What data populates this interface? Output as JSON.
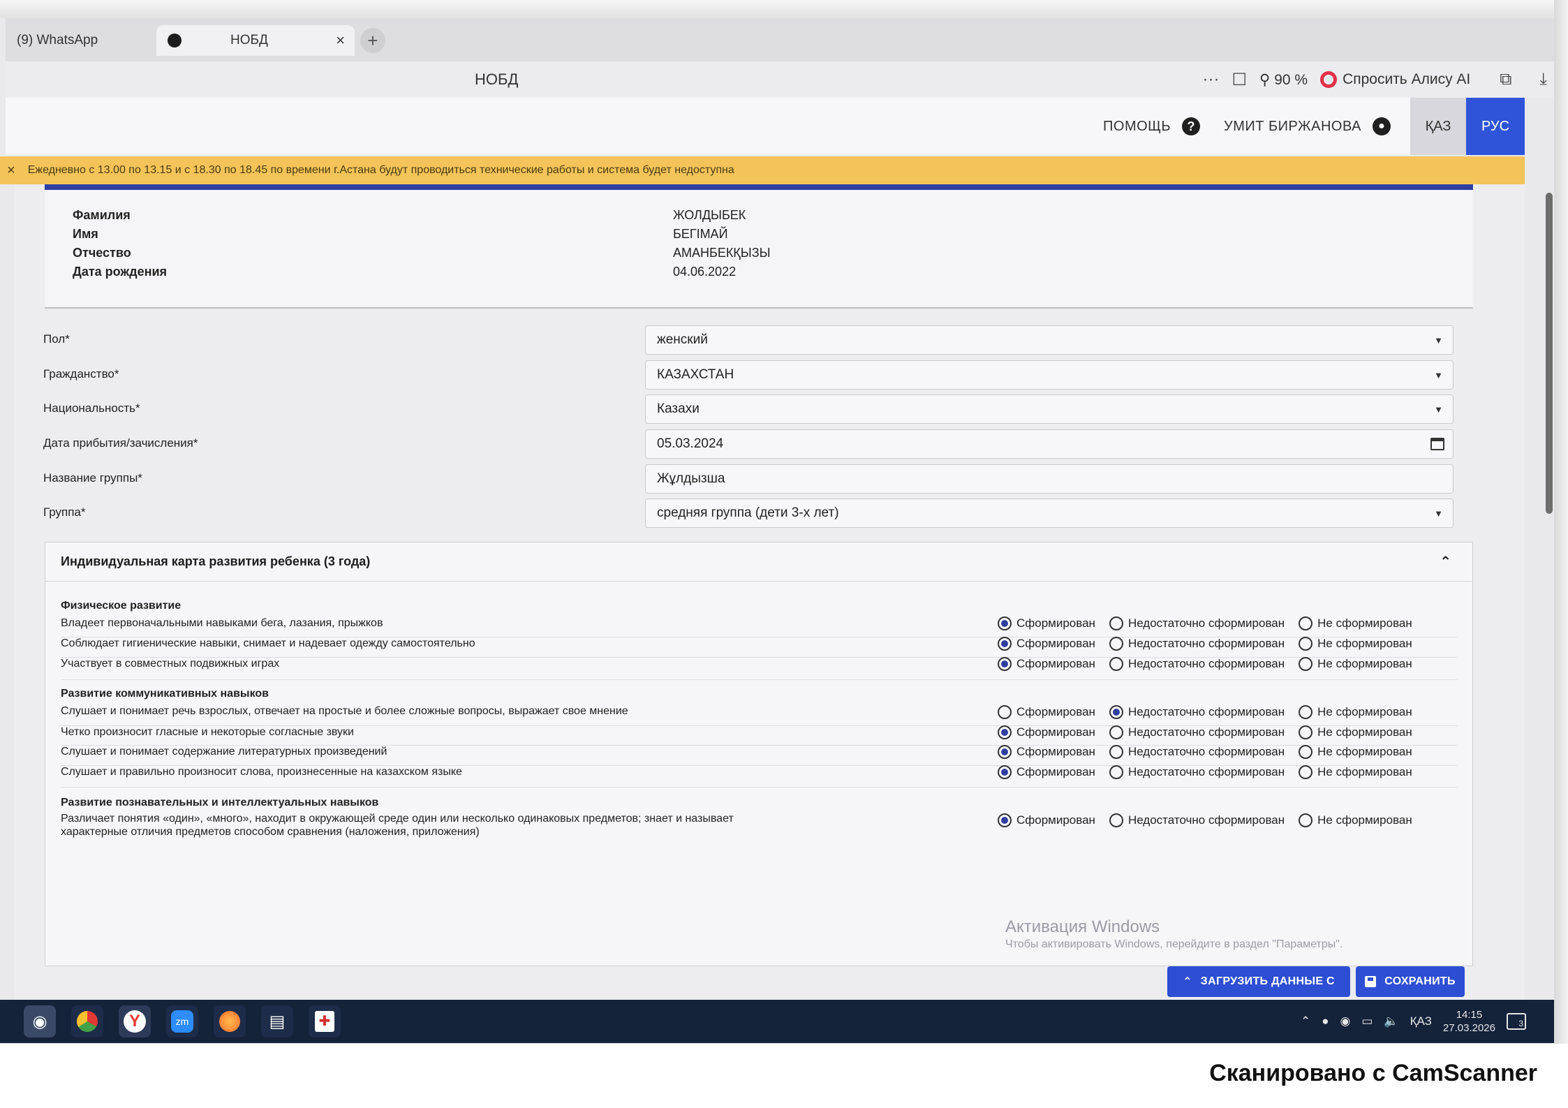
{
  "browser": {
    "tabs": [
      {
        "label": "(9) WhatsApp"
      },
      {
        "label": "НОБД",
        "close": "×"
      }
    ],
    "new_tab": "+",
    "page_title": "НОБД",
    "more": "···",
    "zoom": "90 %",
    "alice_label": "Спросить Алису AI"
  },
  "header": {
    "help": "ПОМОЩЬ",
    "help_icon": "?",
    "user_name": "УМИТ БИРЖАНОВА",
    "lang_kaz": "ҚАЗ",
    "lang_rus": "РУС"
  },
  "banner": {
    "close": "×",
    "text": "Ежедневно с 13.00 по 13.15 и с 18.30 по 18.45 по времени г.Астана будут проводиться технические работы и система будет недоступна"
  },
  "person": {
    "labels": [
      "Фамилия",
      "Имя",
      "Отчество",
      "Дата рождения"
    ],
    "values": [
      "ЖОЛДЫБЕК",
      "БЕГІМАЙ",
      "АМАНБЕКҚЫЗЫ",
      "04.06.2022"
    ]
  },
  "form": {
    "fields": [
      {
        "label": "Пол*",
        "value": "женский"
      },
      {
        "label": "Гражданство*",
        "value": "КАЗАХСТАН"
      },
      {
        "label": "Национальность*",
        "value": "Казахи"
      },
      {
        "label": "Дата прибытия/зачисления*",
        "value": "05.03.2024"
      },
      {
        "label": "Название группы*",
        "value": "Жұлдызша"
      },
      {
        "label": "Группа*",
        "value": "средняя группа (дети 3-х лет)"
      }
    ]
  },
  "card": {
    "title": "Индивидуальная карта развития ребенка (3 года)",
    "options": [
      "Сформирован",
      "Недостаточно сформирован",
      "Не сформирован"
    ],
    "sections": [
      {
        "title": "Физическое развитие",
        "rows": [
          {
            "text": "Владеет первоначальными навыками бега, лазания, прыжков",
            "selected": 0
          },
          {
            "text": "Соблюдает гигиенические навыки, снимает и надевает одежду самостоятельно",
            "selected": 0
          },
          {
            "text": "Участвует в совместных подвижных играх",
            "selected": 0
          }
        ]
      },
      {
        "title": "Развитие коммуникативных навыков",
        "rows": [
          {
            "text": "Слушает и понимает речь взрослых, отвечает на простые и более сложные вопросы, выражает свое мнение",
            "selected": 1
          },
          {
            "text": "Четко произносит гласные и некоторые согласные звуки",
            "selected": 0
          },
          {
            "text": "Слушает и понимает содержание литературных произведений",
            "selected": 0
          },
          {
            "text": "Слушает и правильно произносит слова, произнесенные на казахском языке",
            "selected": 0
          }
        ]
      },
      {
        "title": "Развитие познавательных и интеллектуальных навыков",
        "rows": [
          {
            "text": "Различает понятия «один», «много», находит в окружающей среде один или несколько одинаковых предметов; знает и называет характерные отличия предметов способом сравнения (наложения, приложения)",
            "selected": 0
          }
        ]
      }
    ]
  },
  "windows_watermark": {
    "title": "Активация Windows",
    "subtitle": "Чтобы активировать Windows, перейдите в раздел \"Параметры\"."
  },
  "actions": {
    "load": "ЗАГРУЗИТЬ ДАННЫЕ С",
    "save": "СОХРАНИТЬ"
  },
  "taskbar": {
    "lang": "ҚАЗ",
    "time": "14:15",
    "date": "27.03.2026",
    "notifications": "3"
  },
  "footer": "Сканировано с CamScanner",
  "colors": {
    "accent": "#2e4fd3",
    "banner": "#f4c45a",
    "radio_selected": "#2e3fa0",
    "taskbar": "#14223a"
  }
}
